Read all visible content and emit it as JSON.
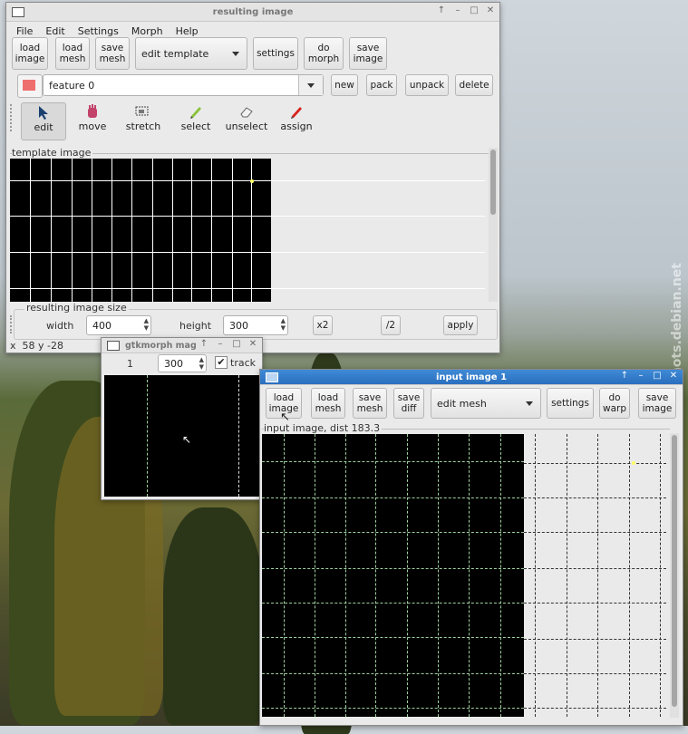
{
  "colors": {
    "accent": "#2a6fbe",
    "feature_swatch": "#ee6e6e",
    "point": "#ffff66"
  },
  "main_window": {
    "title": "resulting image",
    "menu": [
      "File",
      "Edit",
      "Settings",
      "Morph",
      "Help"
    ],
    "toolbar": {
      "load_image": "load\nimage",
      "load_mesh": "load\nmesh",
      "save_mesh": "save\nmesh",
      "mode": "edit template",
      "settings": "settings",
      "do_morph": "do\nmorph",
      "save_image": "save\nimage"
    },
    "feature": {
      "value": "feature 0",
      "new": "new",
      "pack": "pack",
      "unpack": "unpack",
      "delete": "delete"
    },
    "tools": [
      {
        "label": "edit",
        "icon": "arrow-pointer-icon"
      },
      {
        "label": "move",
        "icon": "hand-icon"
      },
      {
        "label": "stretch",
        "icon": "stretch-icon"
      },
      {
        "label": "select",
        "icon": "pencil-icon"
      },
      {
        "label": "unselect",
        "icon": "eraser-icon"
      },
      {
        "label": "assign",
        "icon": "red-pencil-icon"
      }
    ],
    "template_label": "template image",
    "size": {
      "label": "resulting image size",
      "width_label": "width",
      "width": "400",
      "height_label": "height",
      "height": "300",
      "x2": "x2",
      "half": "/2",
      "apply": "apply"
    },
    "status": "x  58 y -28"
  },
  "mag_window": {
    "title": "gtkmorph mag",
    "zoom": "1",
    "value": "300",
    "track": "track"
  },
  "input_window": {
    "title": "input image 1",
    "toolbar": {
      "load_image": "load\nimage",
      "load_mesh": "load\nmesh",
      "save_mesh": "save\nmesh",
      "save_diff": "save\ndiff",
      "mode": "edit mesh",
      "settings": "settings",
      "do_warp": "do\nwarp",
      "save_image": "save\nimage"
    },
    "image_label": "input image, dist 183.3"
  },
  "watermark": "screenshots.debian.net"
}
